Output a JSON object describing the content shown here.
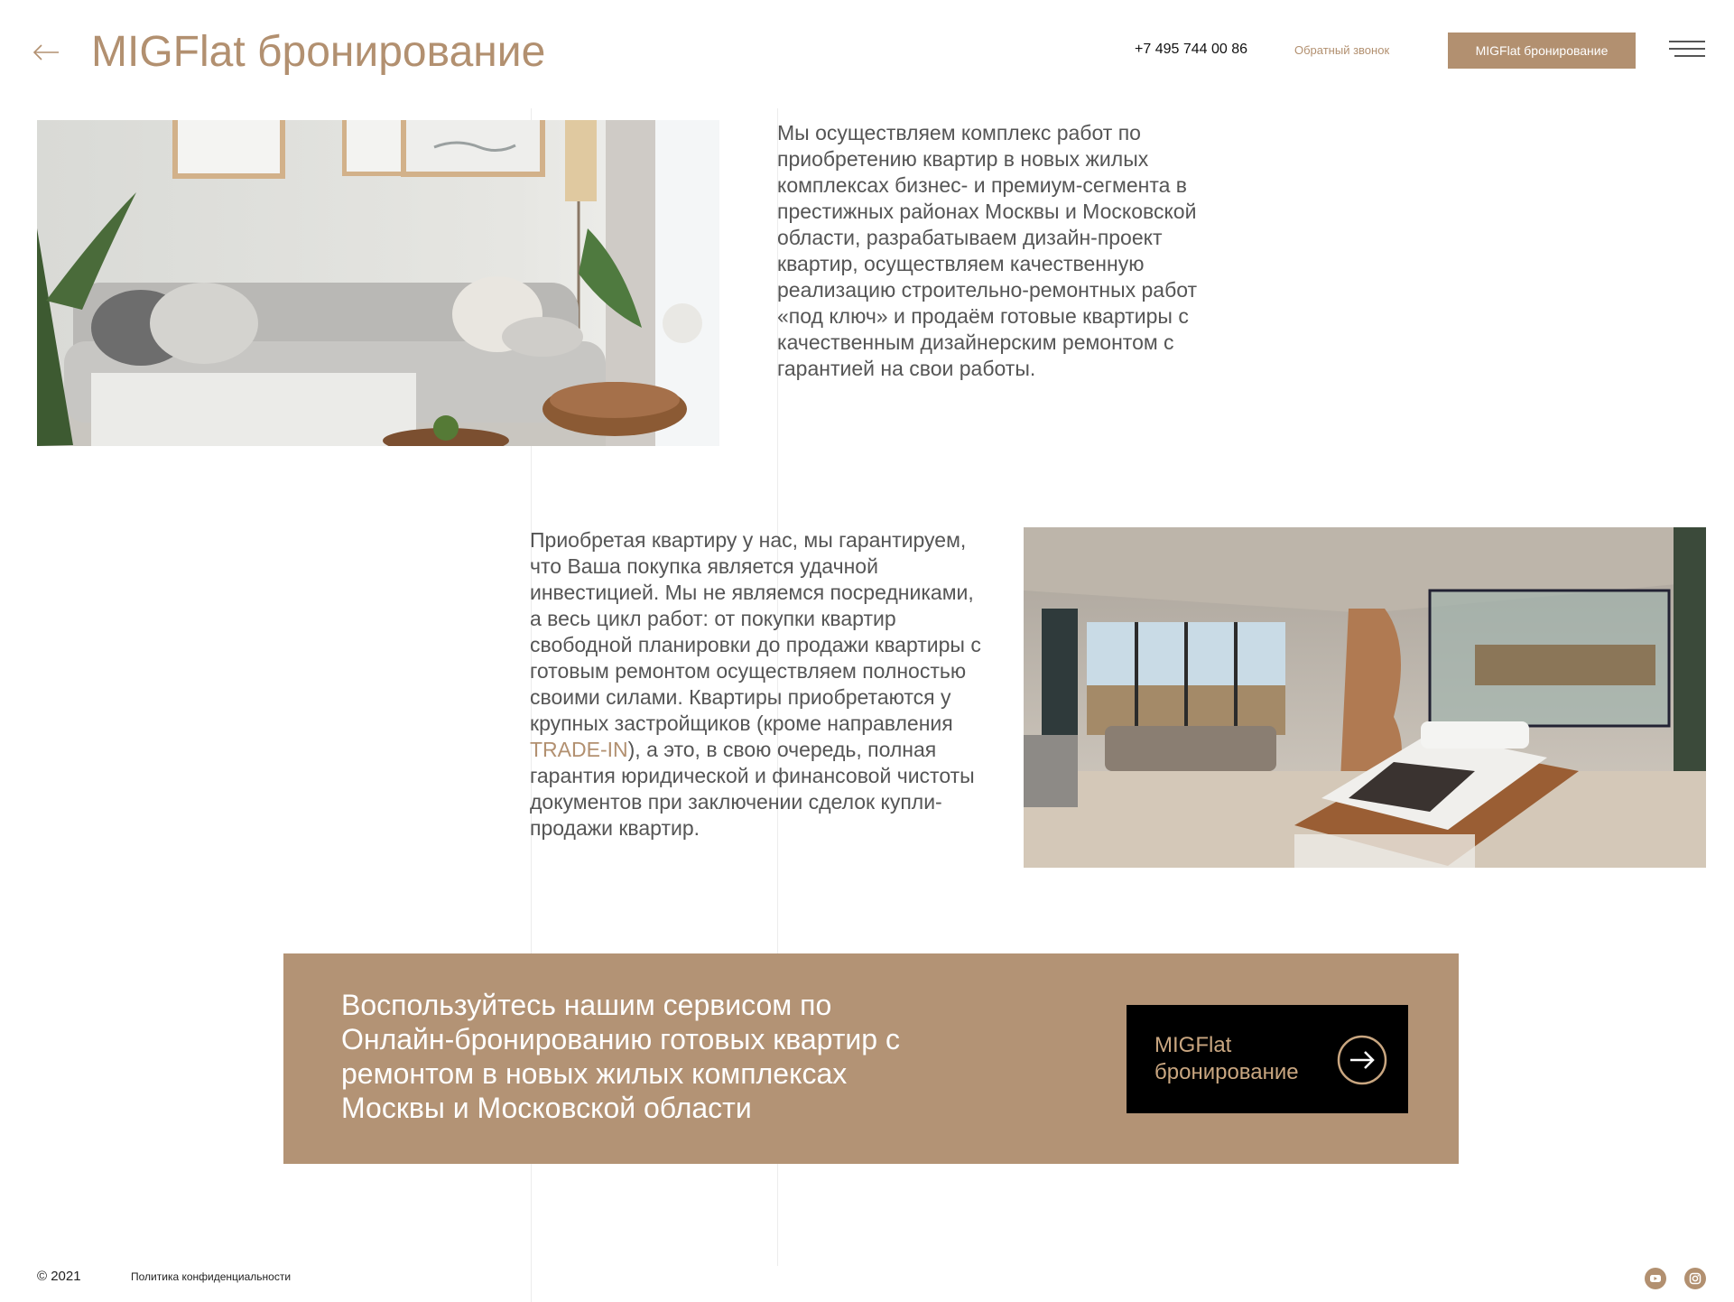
{
  "header": {
    "back_icon": "arrow-left-icon",
    "title": "MIGFlat бронирование",
    "phone": "+7 495 744 00 86",
    "callback_link": "Обратный звонок",
    "booking_button": "MIGFlat бронирование",
    "menu_icon": "hamburger-menu-icon"
  },
  "content": {
    "photo_living_room": "living-room-photo",
    "paragraph_1": "Мы осуществляем комплекс работ по приобретению квартир в новых жилых комплексах бизнес- и премиум-сегмента в престижных районах Москвы и Московской области, разрабатываем дизайн-проект квартир, осуществляем качественную реализацию строительно-ремонтных работ «под ключ» и продаём готовые квартиры с качественным дизайнерским ремонтом с гарантией на свои работы.",
    "paragraph_2_before": "Приобретая квартиру у нас, мы гарантируем, что Ваша покупка является удачной инвестицией. Мы не являемся посредниками, а весь цикл работ: от покупки квартир свободной планировки до продажи квартиры с готовым ремонтом осуществляем полностью своими силами. Квартиры приобретаются у крупных застройщиков (кроме направления ",
    "paragraph_2_link": "TRADE-IN",
    "paragraph_2_after": "), а это, в свою очередь, полная гарантия юридической и финансовой чистоты документов при заключении сделок купли-продажи квартир.",
    "photo_bedroom": "bedroom-photo"
  },
  "promo": {
    "text": "Воспользуйтесь нашим сервисом по Онлайн-бронированию готовых квартир с ремонтом в новых жилых комплексах Москвы и Московской области",
    "button_label": "MIGFlat бронирование",
    "button_icon": "arrow-right-circle-icon"
  },
  "footer": {
    "copyright": "© 2021",
    "privacy_link": "Политика конфиденциальности",
    "social_icons": [
      "youtube-icon",
      "instagram-icon"
    ]
  },
  "colors": {
    "accent": "#b29070",
    "banner": "#b39375",
    "text": "#555555"
  }
}
